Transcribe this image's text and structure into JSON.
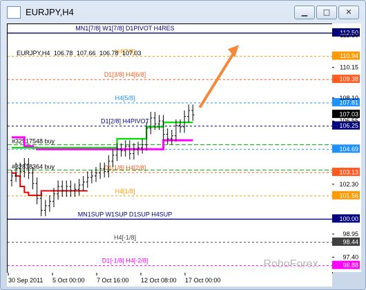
{
  "window": {
    "title": "EURJPY,H4",
    "buttons": {
      "minimize": "▁",
      "maximize": "□",
      "close": "✕"
    }
  },
  "chart": {
    "symbol": "EURJPY,H4",
    "ohlc": [
      "106.78",
      "107.66",
      "106.78",
      "107.03"
    ],
    "current_price": "107.03",
    "watermark": "RoboForex",
    "colors": {
      "res_top": "#000080",
      "h4_7_8": "#ff9900",
      "d1_3_8": "#ff5a1f",
      "h4_5_8": "#1e90ff",
      "d1_2_8": "#000080",
      "h4_2_8": "#ff5a1f",
      "h4_1_8": "#ff9900",
      "sup": "#000080",
      "h4_m1_8": "#404040",
      "d1_m1_8": "#ff00ff",
      "magenta": "#ff00ff",
      "green": "#00e000",
      "red": "#ee0000",
      "arrow": "#f4873a"
    }
  },
  "chart_data": {
    "type": "line",
    "ylim": [
      96.4,
      113.1
    ],
    "yticks": [
      {
        "label": "112.30",
        "v": 112.3
      },
      {
        "label": "110.15",
        "v": 110.15
      },
      {
        "label": "108.10",
        "v": 108.1
      },
      {
        "label": "106.55",
        "v": 106.55
      },
      {
        "label": "102.30",
        "v": 102.3
      },
      {
        "label": "98.95",
        "v": 98.95
      },
      {
        "label": "97.40",
        "v": 97.4
      }
    ],
    "x_labels": [
      "30 Sep 2011",
      "5 Oct 00:00",
      "7 Oct 16:00",
      "12 Oct 08:00",
      "17 Oct 00:00"
    ],
    "levels": [
      {
        "label": "MN1[7/8] W1[7/8] D1PIVOT H4RES",
        "tag": "112.50",
        "v": 112.5,
        "color": "#000080",
        "style": "solid"
      },
      {
        "label": "H4[7/8]",
        "tag": "110.94",
        "v": 110.94,
        "color": "#ff9900",
        "style": "dash"
      },
      {
        "label": "D1[3/8] H4[6/8]",
        "tag": "109.38",
        "v": 109.38,
        "color": "#ff5a1f",
        "style": "dash"
      },
      {
        "label": "H4[5/8]",
        "tag": "107.81",
        "v": 107.81,
        "color": "#1e90ff",
        "style": "dash"
      },
      {
        "label": "D1[2/8] H4PIVOT",
        "tag": "106.25",
        "v": 106.25,
        "color": "#000080",
        "style": "dash"
      },
      {
        "label": "",
        "tag": "104.69",
        "v": 104.69,
        "color": "#1e90ff",
        "style": "dash"
      },
      {
        "label": "D1[1/8] H4[2/8]",
        "tag": "103.13",
        "v": 103.13,
        "color": "#ff5a1f",
        "style": "dash"
      },
      {
        "label": "H4[1/8]",
        "tag": "101.56",
        "v": 101.56,
        "color": "#ff9900",
        "style": "dash"
      },
      {
        "label": "MN1SUP W1SUP D1SUP H4SUP",
        "tag": "100.00",
        "v": 100.0,
        "color": "#000080",
        "style": "solid"
      },
      {
        "label": "H4[-1/8]",
        "tag": "98.44",
        "v": 98.44,
        "color": "#404040",
        "style": "dash"
      },
      {
        "label": "D1[-1/8] H4[-2/8]",
        "tag": "96.88",
        "v": 96.88,
        "color": "#ff00ff",
        "style": "dash"
      }
    ],
    "orders": [
      {
        "label": "#32917548 buy",
        "v": 105.0
      },
      {
        "label": "#32818364 buy",
        "v": 103.3
      }
    ],
    "closes": [
      102.9,
      103.4,
      103.2,
      103.7,
      103.1,
      102.4,
      101.4,
      100.6,
      100.9,
      101.2,
      101.7,
      102.2,
      101.9,
      102.2,
      101.9,
      102.0,
      102.3,
      102.5,
      102.8,
      102.9,
      103.1,
      103.4,
      103.2,
      103.9,
      104.3,
      104.7,
      104.6,
      104.9,
      104.4,
      104.7,
      104.8,
      105.0,
      106.1,
      106.8,
      106.4,
      106.6,
      105.7,
      105.4,
      105.6,
      106.3,
      106.2,
      106.9,
      107.3,
      107.0
    ],
    "green": [
      104.8,
      104.8,
      104.8,
      104.8,
      104.8,
      104.8,
      104.8,
      104.8,
      104.8,
      104.8,
      104.8,
      104.8,
      104.8,
      104.8,
      104.8,
      104.8,
      104.8,
      104.8,
      104.8,
      104.8,
      104.8,
      104.8,
      104.8,
      104.8,
      104.8,
      105.4,
      105.4,
      105.4,
      105.4,
      105.4,
      105.4,
      105.4,
      106.2,
      106.2,
      106.2,
      106.2,
      106.5,
      106.5,
      106.5,
      106.5,
      106.5,
      106.5,
      106.5,
      106.5
    ],
    "red": [
      103.1,
      102.9,
      102.2,
      101.8,
      101.6,
      101.6,
      101.6,
      101.9,
      101.9,
      101.9,
      101.9,
      101.9,
      101.9,
      101.9,
      101.9,
      101.9,
      101.9,
      101.9,
      101.9
    ],
    "magenta": [
      105.5,
      105.5,
      105.5,
      104.9,
      104.9,
      104.8,
      104.7,
      104.7,
      104.7,
      104.7,
      104.7,
      104.7,
      104.7,
      104.7,
      104.7,
      104.7,
      104.7,
      104.7,
      104.7,
      104.7,
      104.7,
      104.7,
      104.7,
      104.7,
      104.7,
      104.7,
      104.7,
      104.7,
      104.7,
      104.7,
      104.7,
      104.7,
      104.7,
      104.7,
      104.7,
      104.7,
      105.3,
      105.3,
      105.3,
      105.3,
      105.3,
      105.3,
      105.3,
      105.3
    ]
  }
}
